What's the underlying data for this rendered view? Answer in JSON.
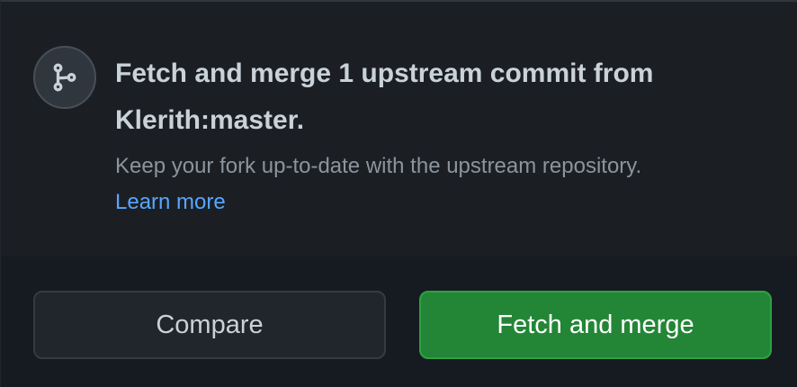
{
  "sync_popover": {
    "icon": "git-branch-icon",
    "title": "Fetch and merge 1 upstream commit from Klerith:master.",
    "description": "Keep your fork up-to-date with the upstream repository.",
    "learn_more": "Learn more",
    "buttons": {
      "compare": "Compare",
      "fetch_merge": "Fetch and merge"
    }
  },
  "colors": {
    "background": "#161b22",
    "header_background": "#1b1f24",
    "text": "#c9d1d9",
    "muted_text": "#8b949e",
    "link": "#58a6ff",
    "primary_button": "#238636",
    "secondary_button": "#21262d"
  }
}
